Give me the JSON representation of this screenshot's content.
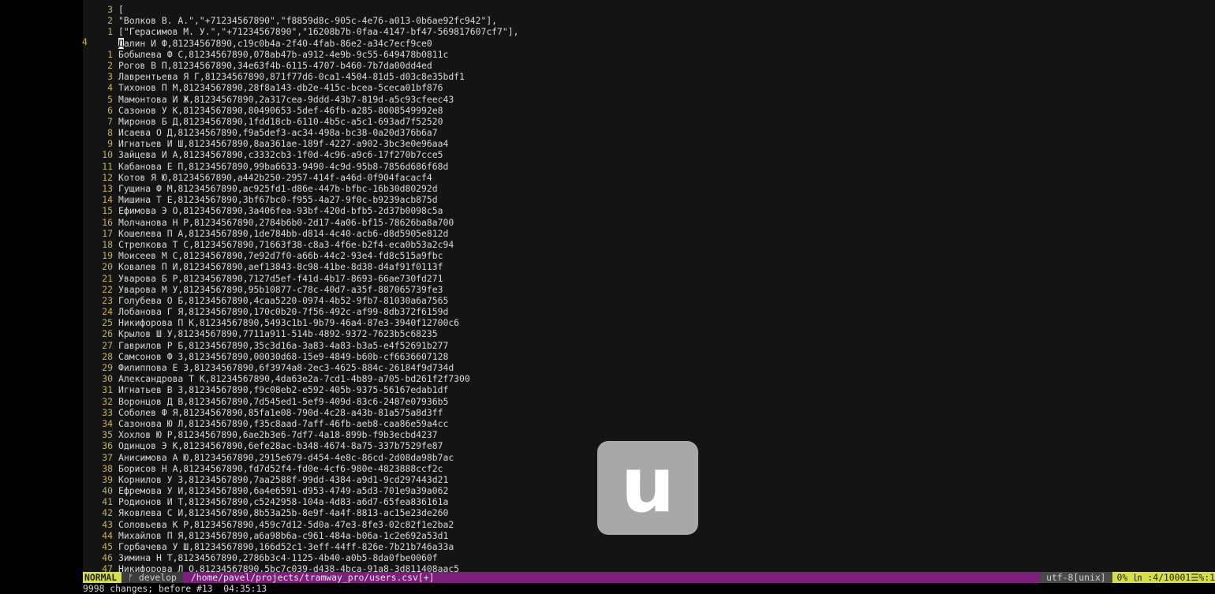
{
  "editor": {
    "outer_line_number": "4",
    "lines": [
      {
        "n": "3",
        "text": "["
      },
      {
        "n": "2",
        "text": "\"Волков В. А.\",\"+71234567890\",\"f8859d8c-905c-4e76-a013-0b6ae92fc942\"],"
      },
      {
        "n": "1",
        "text": "[\"Герасимов М. У.\",\"+71234567890\",\"16208b7b-0faa-4147-bf47-569817607cf7\"],"
      },
      {
        "n": "",
        "cursor": true,
        "cursor_char": "Д",
        "text": "алин И Ф,81234567890,c19c0b4a-2f40-4fab-86e2-a34c7ecf9ce0"
      },
      {
        "n": "1",
        "text": "Бобылева Ф С,81234567890,078ab47b-a912-4e9b-9c55-649478b0811c"
      },
      {
        "n": "2",
        "text": "Рогов В П,81234567890,34e63f4b-6115-4707-b460-7b7da00dd4ed"
      },
      {
        "n": "3",
        "text": "Лаврентьева Я Г,81234567890,871f77d6-0ca1-4504-81d5-d03c8e35bdf1"
      },
      {
        "n": "4",
        "text": "Тихонов П М,81234567890,28f8a143-db2e-415c-bcea-5ceca01bf876"
      },
      {
        "n": "5",
        "text": "Мамонтова И Ж,81234567890,2a317cea-9ddd-43b7-819d-a5c93cfeec43"
      },
      {
        "n": "6",
        "text": "Сазонов У К,81234567890,80490653-5def-46fb-a285-8008549992e8"
      },
      {
        "n": "7",
        "text": "Миронов Б Д,81234567890,1fdd18cb-6110-4b5c-a5c1-693ad7f52520"
      },
      {
        "n": "8",
        "text": "Исаева О Д,81234567890,f9a5def3-ac34-498a-bc38-0a20d376b6a7"
      },
      {
        "n": "9",
        "text": "Игнатьев И Ш,81234567890,8aa361ae-189f-4227-a902-3bc3e0e96aa4"
      },
      {
        "n": "10",
        "text": "Зайцева И А,81234567890,c3332cb3-1f0d-4c96-a9c6-17f270b7cce5"
      },
      {
        "n": "11",
        "text": "Кабанова Е П,81234567890,99ba6633-9490-4c9d-95b8-7856d686f68d"
      },
      {
        "n": "12",
        "text": "Котов Я Ю,81234567890,a442b250-2957-414f-a46d-0f904facacf4"
      },
      {
        "n": "13",
        "text": "Гущина Ф М,81234567890,ac925fd1-d86e-447b-bfbc-16b30d80292d"
      },
      {
        "n": "14",
        "text": "Мишина Т Е,81234567890,3bf67bc0-f955-4a27-9f0c-b9239acb875d"
      },
      {
        "n": "15",
        "text": "Ефимова Э О,81234567890,3a406fea-93bf-420d-bfb5-2d37b0098c5a"
      },
      {
        "n": "16",
        "text": "Молчанова Н Р,81234567890,2784b6b0-2d17-4a06-bf15-78626ba8a700"
      },
      {
        "n": "17",
        "text": "Кошелева П А,81234567890,1de784bb-d814-4c40-acb6-d8d5905e812d"
      },
      {
        "n": "18",
        "text": "Стрелкова Т С,81234567890,71663f38-c8a3-4f6e-b2f4-eca0b53a2c94"
      },
      {
        "n": "19",
        "text": "Моисеев М С,81234567890,7e92d7f0-a66b-44c2-93e4-fd8c515a9fbc"
      },
      {
        "n": "20",
        "text": "Ковалев П И,81234567890,aef13843-8c98-41be-8d38-d4af91f0113f"
      },
      {
        "n": "21",
        "text": "Уварова Б Р,81234567890,7127d5ef-f41d-4b17-8693-66ae730fd271"
      },
      {
        "n": "22",
        "text": "Уварова М У,81234567890,95b10877-c78c-40d7-a35f-887065739fe3"
      },
      {
        "n": "23",
        "text": "Голубева О Б,81234567890,4caa5220-0974-4b52-9fb7-81030a6a7565"
      },
      {
        "n": "24",
        "text": "Лобанова Г Я,81234567890,170c0b20-7f56-492c-af99-8db372f6159d"
      },
      {
        "n": "25",
        "text": "Никифорова П К,81234567890,5493c1b1-9b79-46a4-87e3-3940f12700c6"
      },
      {
        "n": "26",
        "text": "Крылов Ш У,81234567890,7711a911-514b-4892-9372-7623b5c68235"
      },
      {
        "n": "27",
        "text": "Гаврилов Р Б,81234567890,35c3d16a-3a83-4a83-b3a5-e4f52691b277"
      },
      {
        "n": "28",
        "text": "Самсонов Ф З,81234567890,00030d68-15e9-4849-b60b-cf6636607128"
      },
      {
        "n": "29",
        "text": "Филиппова Е З,81234567890,6f3974a8-2ec3-4625-884c-26184f9d734d"
      },
      {
        "n": "30",
        "text": "Александрова Т К,81234567890,4da63e2a-7cd1-4b89-a705-bd261f2f7300"
      },
      {
        "n": "31",
        "text": "Игнатьев В З,81234567890,f9c08eb2-e592-405b-9375-56167edab1df"
      },
      {
        "n": "32",
        "text": "Воронцов Д В,81234567890,7d545ed1-5ef9-409d-83c6-2487e07936b5"
      },
      {
        "n": "33",
        "text": "Соболев Ф Я,81234567890,85fa1e08-790d-4c28-a43b-81a575a8d3ff"
      },
      {
        "n": "34",
        "text": "Сазонова Ю Л,81234567890,f35c8aad-7aff-46fb-aeb8-caa86e59a4cc"
      },
      {
        "n": "35",
        "text": "Хохлов Ю Р,81234567890,6ae2b3e6-7df7-4a18-899b-f9b3ecbd4237"
      },
      {
        "n": "36",
        "text": "Одинцов Э К,81234567890,6efe28ac-b348-4674-8a75-337b7529fe87"
      },
      {
        "n": "37",
        "text": "Анисимова А Ю,81234567890,2915e679-d454-4e8c-86cd-2d08da98b7ac"
      },
      {
        "n": "38",
        "text": "Борисов Н А,81234567890,fd7d52f4-fd0e-4cf6-980e-4823888ccf2c"
      },
      {
        "n": "39",
        "text": "Корнилов У З,81234567890,7aa2588f-99dd-4384-a9d1-9cd297443d21"
      },
      {
        "n": "40",
        "text": "Ефремова У И,81234567890,6a4e6591-d953-4749-a5d3-701e9a39a062"
      },
      {
        "n": "41",
        "text": "Родионов И Т,81234567890,c5242958-104a-4d83-a6d7-65fea836161a"
      },
      {
        "n": "42",
        "text": "Яковлева С И,81234567890,8b53a25b-8e9f-4a4f-8813-ac15e23de260"
      },
      {
        "n": "43",
        "text": "Соловьева К Р,81234567890,459c7d12-5d0a-47e3-8fe3-02c82f1e2ba2"
      },
      {
        "n": "44",
        "text": "Михайлов П Я,81234567890,a6a98b6a-c961-484a-b06a-1c2e692a53d1"
      },
      {
        "n": "45",
        "text": "Горбачева У Ш,81234567890,166d52c1-3eff-44ff-826e-7b21b746a33a"
      },
      {
        "n": "46",
        "text": "Зимина Н Т,81234567890,2786b3c4-1125-4b40-a0b5-8da0fbe0060f"
      },
      {
        "n": "47",
        "text": "Никифорова Л О,81234567890,5bc7c039-d438-4bca-91a8-3d811408aac5"
      }
    ]
  },
  "statusline": {
    "mode": "NORMAL",
    "branch": "ᚠ develop",
    "file": "/home/pavel/projects/tramway_pro/users.csv[+]",
    "encoding": "utf-8[unix]",
    "position": "0% ㏑ :4/10001☰%:1"
  },
  "message": "9998 changes; before #13  04:35:13",
  "logo": {
    "letter": "u"
  },
  "colors": {
    "background": "#141414",
    "line_number": "#c8b34a",
    "text": "#d9d9d9",
    "statusline": "#7b1f7b",
    "mode": "#d6e043"
  }
}
